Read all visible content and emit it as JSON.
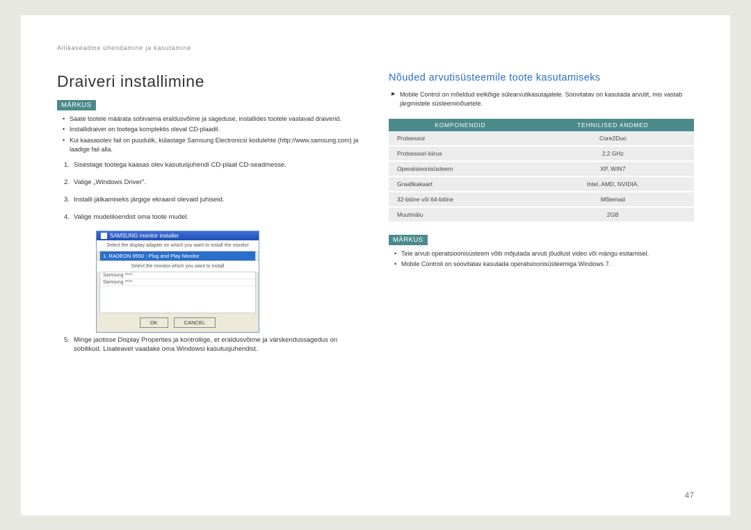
{
  "header": "Allikaseadme ühendamine ja kasutamine",
  "left": {
    "title": "Draiveri installimine",
    "markus": "MÄRKUS",
    "bullets": [
      "Saate tootele määrata sobivaima eraldusvõime ja sageduse, installides tootele vastavad draiverid.",
      "Installidraiver on tootega komplektis oleval CD-plaadil.",
      "Kui kaasasolev fail on puudulik, külastage Samsung Electronicsi kodulehte (http://www.samsung.com) ja laadige fail alla."
    ],
    "steps": [
      "Sisestage tootega kaasas olev kasutusjuhendi CD-plaat CD-seadmesse.",
      "Valige „Windows Driver\".",
      "Installi jätkamiseks järgige ekraanil olevaid juhiseid.",
      "Valige mudeliloendist oma toote mudel.",
      "Minge jaotisse Display Properties ja kontrollige, et eraldusvõime ja värskendussagedus on sobilikud. Lisateavet vaadake oma Windowsi kasutusjuhendist."
    ],
    "dialog": {
      "title": "SAMSUNG monitor installer",
      "instr1": "Select the display adapter on which you want to install the monitor",
      "selected": "1. RADEON 9550 : Plug and Play Monitor",
      "instr2": "Select the monitor which you want to install",
      "list": [
        "Samsung ****",
        "Samsung ****"
      ],
      "ok": "OK",
      "cancel": "CANCEL"
    }
  },
  "right": {
    "title": "Nõuded arvutisüsteemile toote kasutamiseks",
    "intro": "Mobile Control on mõeldud eelkõige sülearvutikasutajatele. Soovitatav on kasutada arvutit, mis vastab järgmistele süsteeminõuetele.",
    "table": {
      "head1": "KOMPONENDID",
      "head2": "TEHNILISED ANDMED",
      "rows": [
        [
          "Protsessor",
          "Core2Duo"
        ],
        [
          "Protsessori kiirus",
          "2,2 GHz"
        ],
        [
          "Operatsioonisüsteem",
          "XP, WIN7"
        ],
        [
          "Graafikakaart",
          "Intel, AMD, NVIDIA."
        ],
        [
          "32-bitine või 64-bitine",
          "Mõlemad"
        ],
        [
          "Muutmälu",
          "2GB"
        ]
      ]
    },
    "markus": "MÄRKUS",
    "notes": [
      "Teie arvuti operatsioonisüsteem võib mõjutada arvuti jõudlust video või mängu esitamisel.",
      "Mobile Controli on soovitatav kasutada operatsioonisüsteemiga Windows 7."
    ]
  },
  "page_num": "47"
}
